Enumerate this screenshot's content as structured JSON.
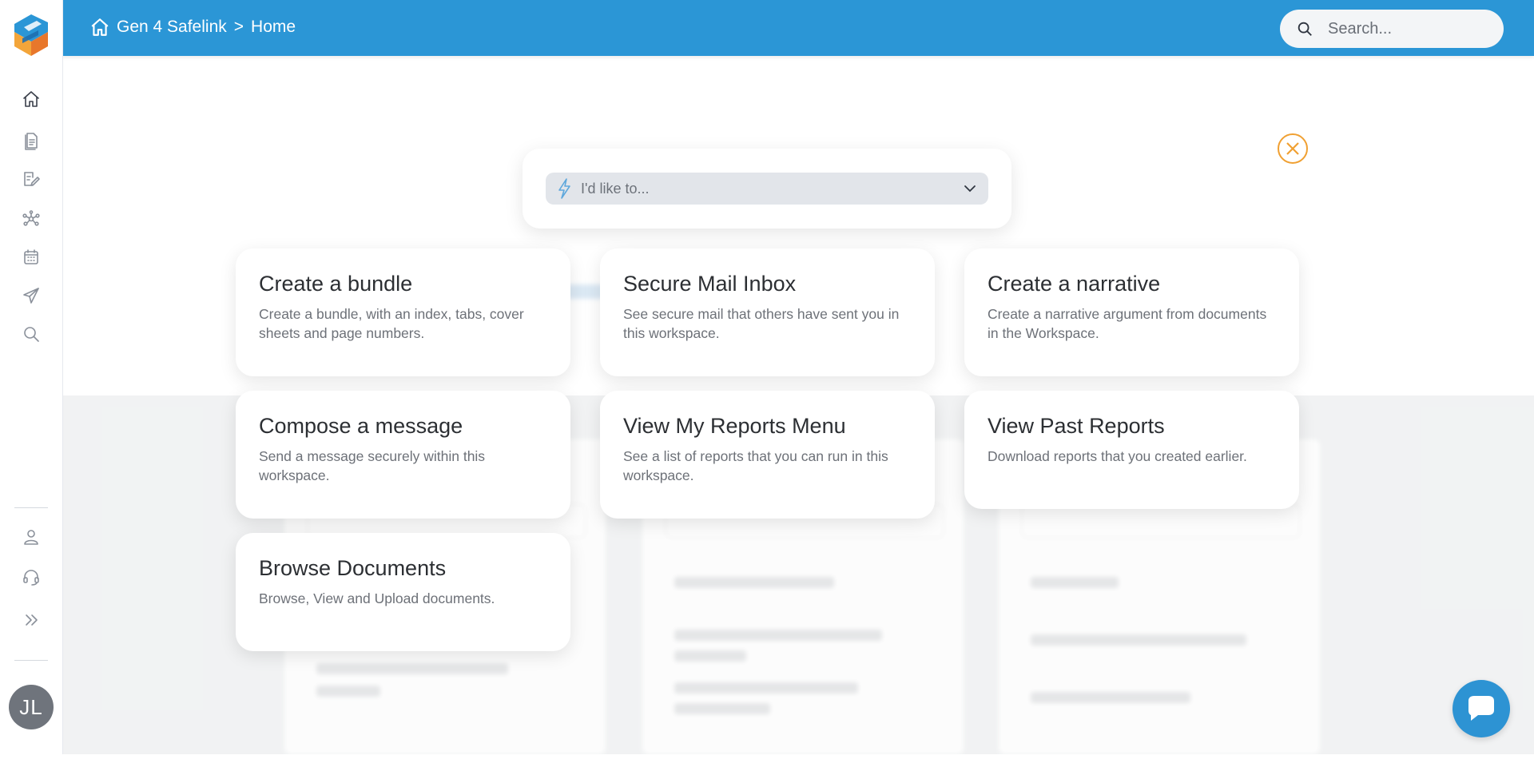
{
  "header": {
    "breadcrumb": [
      "Gen 4 Safelink",
      "Home"
    ],
    "breadcrumb_separator": ">",
    "search_placeholder": "Search...",
    "color": "#2b96d6"
  },
  "sidebar": {
    "items": [
      {
        "name": "home",
        "icon": "home-icon"
      },
      {
        "name": "documents",
        "icon": "document-icon"
      },
      {
        "name": "narrative",
        "icon": "edit-document-icon"
      },
      {
        "name": "network",
        "icon": "network-icon"
      },
      {
        "name": "calendar",
        "icon": "calendar-icon"
      },
      {
        "name": "send",
        "icon": "send-icon"
      },
      {
        "name": "search",
        "icon": "search-icon"
      }
    ],
    "bottom_items": [
      {
        "name": "profile",
        "icon": "user-icon"
      },
      {
        "name": "support",
        "icon": "headset-icon"
      },
      {
        "name": "expand",
        "icon": "double-chevron-right-icon"
      }
    ],
    "avatar_initials": "JL"
  },
  "picker": {
    "placeholder": "I'd like to..."
  },
  "cards": [
    {
      "title": "Create a bundle",
      "description": "Create a bundle, with an index, tabs, cover sheets and page numbers."
    },
    {
      "title": "Secure Mail Inbox",
      "description": "See secure mail that others have sent you in this workspace."
    },
    {
      "title": "Create a narrative",
      "description": "Create a narrative argument from documents in the Workspace."
    },
    {
      "title": "Compose a message",
      "description": "Send a message securely within this workspace."
    },
    {
      "title": "View My Reports Menu",
      "description": "See a list of reports that you can run in this workspace."
    },
    {
      "title": "View Past Reports",
      "description": "Download reports that you created earlier."
    },
    {
      "title": "Browse Documents",
      "description": "Browse, View and Upload documents."
    }
  ],
  "colors": {
    "accent": "#2b96d6",
    "close": "#f0a032",
    "chat": "#2d93d3"
  }
}
